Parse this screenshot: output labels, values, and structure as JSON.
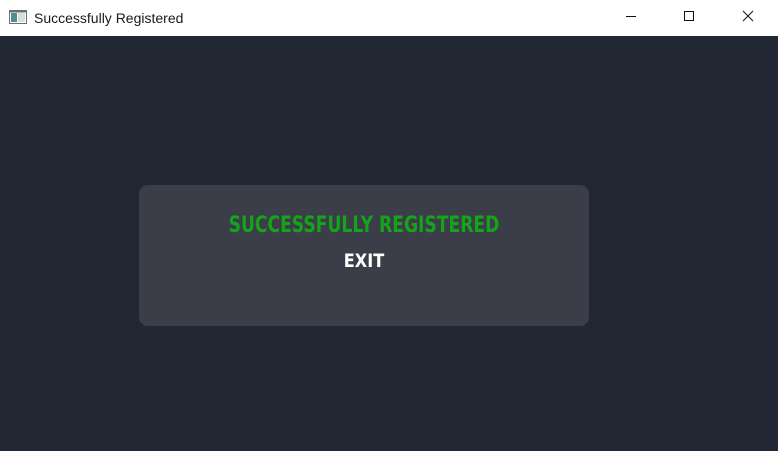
{
  "window": {
    "title": "Successfully Registered",
    "icon": "app-window-icon",
    "controls": {
      "minimize_icon": "minimize-icon",
      "maximize_icon": "maximize-icon",
      "close_icon": "close-icon"
    }
  },
  "dialog": {
    "message": "SUCCESSFULLY REGISTERED",
    "exit_label": "EXIT"
  },
  "colors": {
    "background": "#222833",
    "panel": "#3b3e48",
    "message": "#15a31a",
    "button_text": "#ffffff",
    "titlebar": "#ffffff"
  }
}
